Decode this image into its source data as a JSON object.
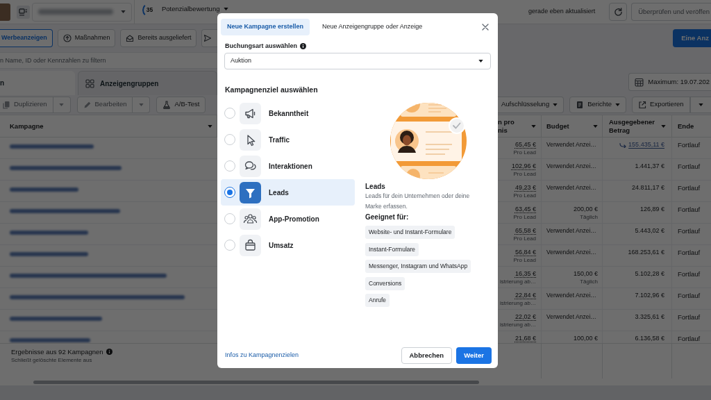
{
  "header": {
    "score": "35",
    "score_label": "Potenzialbewertung",
    "status": "gerade eben aktualisiert",
    "review_button": "Überprüfen und veröffen"
  },
  "action_bar": {
    "buttons": [
      {
        "label": "Werbeanzeigen",
        "selected": true
      },
      {
        "label": "Maßnahmen",
        "selected": false
      },
      {
        "label": "Bereits ausgeliefert",
        "selected": false
      }
    ],
    "create_button": "Eine Anz"
  },
  "search": {
    "placeholder": "n Name, ID oder Kennzahlen zu filtern"
  },
  "level_tabs": [
    {
      "label": "n",
      "selected": true
    },
    {
      "label": "Anzeigengruppen",
      "selected": false
    }
  ],
  "date_range": "Maximum: 19.07.202",
  "toolbar_left": [
    {
      "label": "Duplizieren",
      "disabled": true,
      "kind": "split"
    },
    {
      "label": "Bearbeiten",
      "disabled": true,
      "kind": "split"
    },
    {
      "label": "A/B-Test",
      "disabled": false,
      "kind": "plain"
    }
  ],
  "toolbar_right": [
    {
      "label": "Aufschlüsselung",
      "kind": "dropdown"
    },
    {
      "label": "Berichte",
      "kind": "dropdown"
    },
    {
      "label": "Exportieren",
      "kind": "split"
    }
  ],
  "table": {
    "columns": [
      {
        "label": "Kampagne",
        "menu": true
      },
      {
        "label": "n pro nis",
        "menu": true
      },
      {
        "label": "Budget",
        "menu": true
      },
      {
        "label": "Ausgegebener Betrag",
        "menu": true
      },
      {
        "label": "Ende",
        "menu": false
      }
    ],
    "rows": [
      {
        "cost": "65,45 €",
        "cost_note": "Pro Lead",
        "budget": {
          "kind": "text",
          "text": "Verwendet Anzei…"
        },
        "spent": "155.435,11 €",
        "spent_link": true,
        "end": "Fortlauf"
      },
      {
        "cost": "102,96 €",
        "cost_note": "Pro Lead",
        "budget": {
          "kind": "text",
          "text": "Verwendet Anzei…"
        },
        "spent": "1.441,37 €",
        "spent_link": false,
        "end": "Fortlauf"
      },
      {
        "cost": "49,23 €",
        "cost_note": "Pro Lead",
        "budget": {
          "kind": "text",
          "text": "Verwendet Anzei…"
        },
        "spent": "24.811,17 €",
        "spent_link": false,
        "end": "Fortlauf"
      },
      {
        "cost": "63,45 €",
        "cost_note": "Pro Lead",
        "budget": {
          "kind": "amount",
          "text": "200,00 €",
          "note": "Täglich"
        },
        "spent": "126,89 €",
        "spent_link": false,
        "end": "Fortlauf"
      },
      {
        "cost": "65,58 €",
        "cost_note": "Pro Lead",
        "budget": {
          "kind": "text",
          "text": "Verwendet Anzei…"
        },
        "spent": "5.443,02 €",
        "spent_link": false,
        "end": "Fortlauf"
      },
      {
        "cost": "56,84 €",
        "cost_note": "Pro Lead",
        "budget": {
          "kind": "text",
          "text": "Verwendet Anzei…"
        },
        "spent": "168.253,61 €",
        "spent_link": false,
        "end": "Fortlauf"
      },
      {
        "cost": "16,35 €",
        "cost_note": "istrierung ab…",
        "budget": {
          "kind": "amount",
          "text": "150,00 €",
          "note": "Täglich"
        },
        "spent": "5.102,28 €",
        "spent_link": false,
        "end": "Fortlauf"
      },
      {
        "cost": "22,84 €",
        "cost_note": "istrierung ab…",
        "budget": {
          "kind": "text",
          "text": "Verwendet Anzei…"
        },
        "spent": "7.102,96 €",
        "spent_link": false,
        "end": "Fortlauf"
      },
      {
        "cost": "22,02 €",
        "cost_note": "istrierung ab…",
        "budget": {
          "kind": "text",
          "text": "Verwendet Anzei…"
        },
        "spent": "3.325,61 €",
        "spent_link": false,
        "end": "Fortlauf"
      },
      {
        "cost": "21,68 €",
        "budget": {
          "kind": "amount",
          "text": "100,00 €"
        },
        "spent": "6.136,58 €",
        "spent_link": false,
        "end": "Fortlauf"
      }
    ],
    "summary": "Ergebnisse aus 92 Kampagnen",
    "summary_note": "Schließt gelöschte Elemente aus"
  },
  "dialog": {
    "tabs": [
      {
        "label": "Neue Kampagne erstellen",
        "selected": true
      },
      {
        "label": "Neue Anzeigengruppe oder Anzeige",
        "selected": false
      }
    ],
    "buying_type": {
      "label": "Buchungsart auswählen",
      "value": "Auktion"
    },
    "objective_heading": "Kampagnenziel auswählen",
    "objectives": [
      {
        "label": "Bekanntheit",
        "selected": false
      },
      {
        "label": "Traffic",
        "selected": false
      },
      {
        "label": "Interaktionen",
        "selected": false
      },
      {
        "label": "Leads",
        "selected": true
      },
      {
        "label": "App-Promotion",
        "selected": false
      },
      {
        "label": "Umsatz",
        "selected": false
      }
    ],
    "detail": {
      "title": "Leads",
      "description": "Leads für dein Unternehmen oder deine Marke erfassen.",
      "suited_heading": "Geeignet für:",
      "suited": [
        "Website- und Instant-Formulare",
        "Instant-Formulare",
        "Messenger, Instagram und WhatsApp",
        "Conversions",
        "Anrufe"
      ]
    },
    "info_link": "Infos zu Kampagnenzielen",
    "buttons": [
      {
        "label": "Abbrechen",
        "kind": "secondary"
      },
      {
        "label": "Weiter",
        "kind": "primary"
      }
    ]
  }
}
